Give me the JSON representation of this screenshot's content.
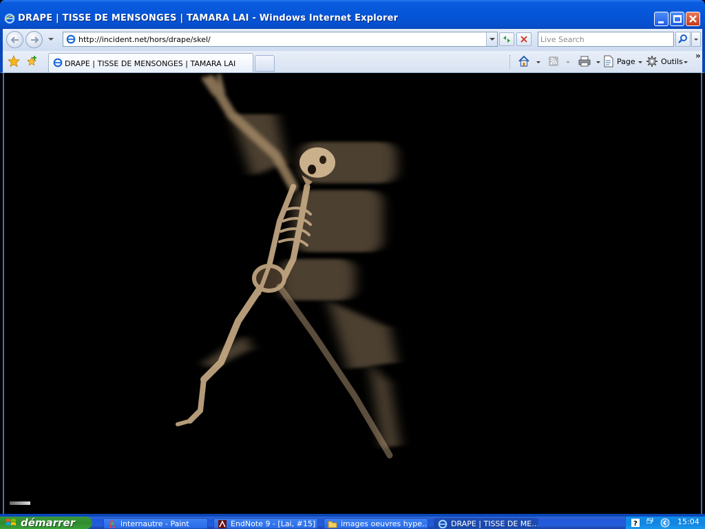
{
  "window": {
    "title": "DRAPE | TISSE DE MENSONGES | TAMARA LAI - Windows Internet Explorer",
    "icon": "ie-icon",
    "controls": [
      "minimize-icon",
      "maximize-icon",
      "close-icon"
    ]
  },
  "address_bar": {
    "url": "http://incident.net/hors/drape/skel/",
    "search_placeholder": "Live Search"
  },
  "tabs": [
    {
      "label": "DRAPE | TISSE DE MENSONGES | TAMARA LAI",
      "active": true
    }
  ],
  "command_bar": {
    "page_label": "Page",
    "tools_label": "Outils"
  },
  "content": {
    "background": "#000000",
    "figure_color": "#c8ab86"
  },
  "taskbar": {
    "start_label": "démarrer",
    "items": [
      {
        "label": "internautre - Paint",
        "icon": "paint-icon",
        "active": false
      },
      {
        "label": "EndNote 9 - [Lai, #15]",
        "icon": "endnote-icon",
        "active": false
      },
      {
        "label": "images oeuvres hype...",
        "icon": "folder-icon",
        "active": false
      },
      {
        "label": "DRAPE | TISSE DE ME...",
        "icon": "ie-icon",
        "active": true
      }
    ],
    "clock": "15:04"
  }
}
